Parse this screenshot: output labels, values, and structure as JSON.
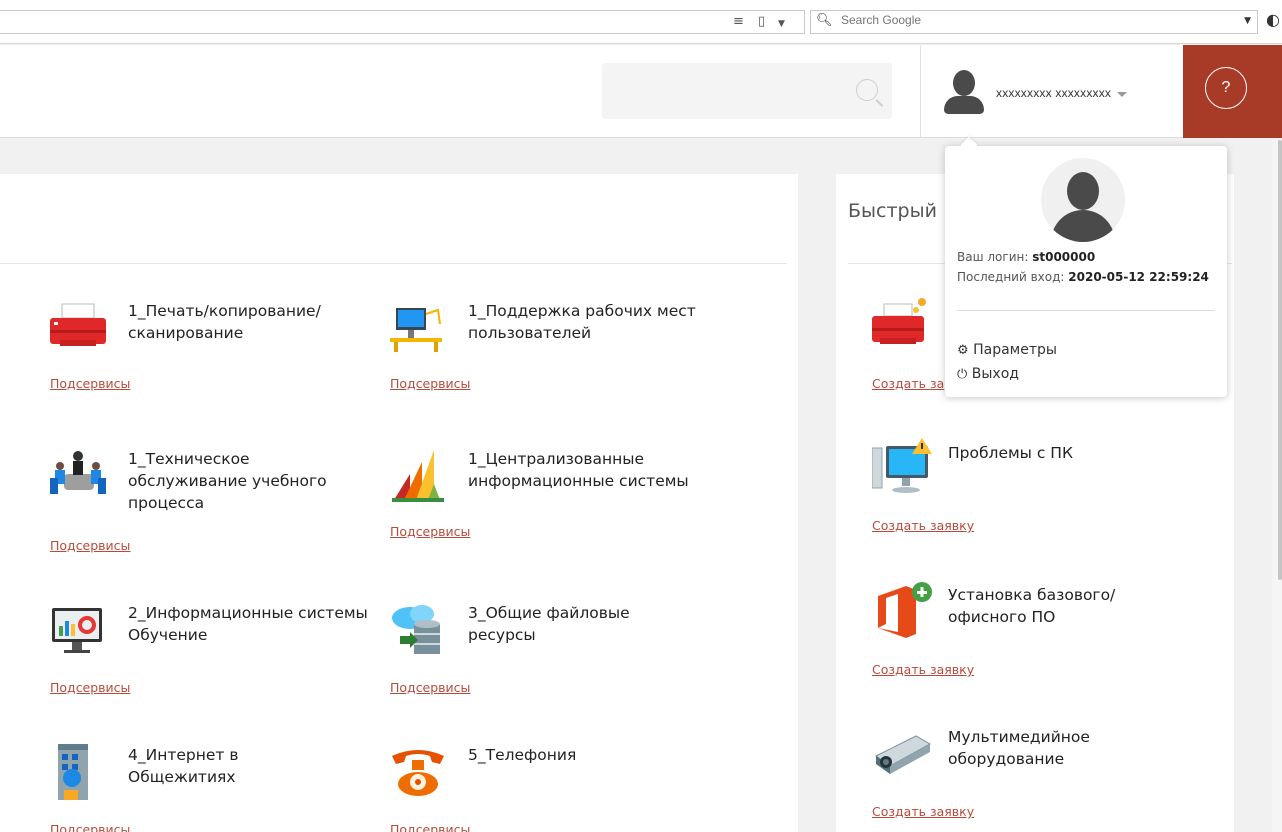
{
  "browser": {
    "search_placeholder": "Search Google"
  },
  "header": {
    "user_name": "xxxxxxxxx xxxxxxxxx",
    "help_label": "?"
  },
  "services": [
    {
      "title_l1": "1_Печать/копирование/",
      "title_l2": "сканирование",
      "title_l3": "",
      "link": "Подсервисы",
      "icon": "printer-icon"
    },
    {
      "title_l1": "1_Поддержка рабочих мест",
      "title_l2": "пользователей",
      "title_l3": "",
      "link": "Подсервисы",
      "icon": "workstation-icon"
    },
    {
      "title_l1": "1_Техническое",
      "title_l2": "обслуживание учебного",
      "title_l3": "процесса",
      "link": "Подсервисы",
      "icon": "meeting-icon"
    },
    {
      "title_l1": "1_Централизованные",
      "title_l2": "информационные системы",
      "title_l3": "",
      "link": "Подсервисы",
      "icon": "dynamics-logo-icon"
    },
    {
      "title_l1": "2_Информационные системы",
      "title_l2": "Обучение",
      "title_l3": "",
      "link": "Подсервисы",
      "icon": "monitor-settings-icon"
    },
    {
      "title_l1": "3_Общие файловые",
      "title_l2": "ресурсы",
      "title_l3": "",
      "link": "Подсервисы",
      "icon": "cloud-database-icon"
    },
    {
      "title_l1": "4_Интернет в",
      "title_l2": "Общежитиях",
      "title_l3": "",
      "link": "Подсервисы",
      "icon": "building-icon"
    },
    {
      "title_l1": "5_Телефония",
      "title_l2": "",
      "title_l3": "",
      "link": "Подсервисы",
      "icon": "telephone-icon"
    }
  ],
  "quick": {
    "title": "Быстрый",
    "items": [
      {
        "title_l1": "",
        "title_l2": "",
        "link": "Создать за",
        "icon": "printer-gear-icon"
      },
      {
        "title_l1": "Проблемы с ПК",
        "title_l2": "",
        "link": "Создать заявку",
        "icon": "pc-warning-icon"
      },
      {
        "title_l1": "Установка базового/",
        "title_l2": "офисного ПО",
        "link": "Создать заявку",
        "icon": "office-add-icon"
      },
      {
        "title_l1": "Мультимедийное",
        "title_l2": "оборудование",
        "link": "Создать заявку",
        "icon": "projector-icon"
      }
    ]
  },
  "user_popup": {
    "login_label": "Ваш логин:",
    "login_value": "st000000",
    "last_login_label": "Последний вход:",
    "last_login_value": "2020-05-12 22:59:24",
    "params_label": "Параметры",
    "logout_label": "Выход"
  },
  "colors": {
    "accent": "#a83a28",
    "link": "#b94a3a"
  }
}
